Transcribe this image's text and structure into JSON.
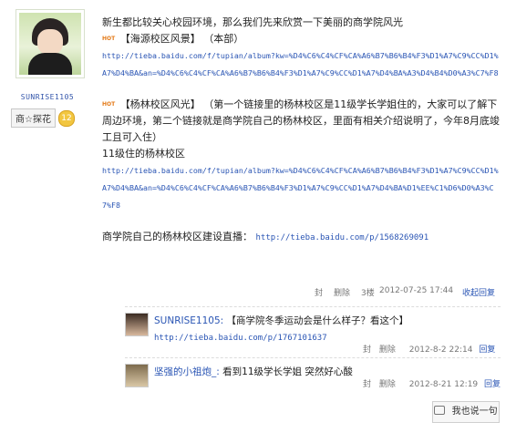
{
  "author": {
    "username": "SUNRISE1105",
    "badge_name": "商☆探花",
    "badge_level": "12"
  },
  "post": {
    "hot_tag": "HOT",
    "line1": "新生都比较关心校园环境，那么我们先来欣赏一下美丽的商学院风光",
    "section1_title": "【海源校区风景】",
    "section1_note": "（本部）",
    "link1": "http://tieba.baidu.com/f/tupian/album?kw=%D4%C6%C4%CF%CA%A6%B7%B6%B4%F3%D1%A7%C9%CC%D1%A7%D4%BA&an=%D4%C6%C4%CF%CA%A6%B7%B6%B4%F3%D1%A7%C9%CC%D1%A7%D4%BA%A3%D4%B4%D0%A3%C7%F8",
    "section2_title": "【杨林校区风光】",
    "section2_desc": "（第一个链接里的杨林校区是11级学长学姐住的，大家可以了解下周边环境，第二个链接就是商学院自己的杨林校区，里面有相关介绍说明了，今年8月底竣工且可入住）",
    "line_11": "11级住的杨林校区",
    "link2": "http://tieba.baidu.com/f/tupian/album?kw=%D4%C6%C4%CF%CA%A6%B7%B6%B4%F3%D1%A7%C9%CC%D1%A7%D4%BA&an=%D4%C6%C4%CF%CA%A6%B7%B6%B4%F3%D1%A7%C9%CC%D1%A7%D4%BA%D1%EE%C1%D6%D0%A3%C7%F8",
    "live_label": "商学院自己的杨林校区建设直播：",
    "live_link": "http://tieba.baidu.com/p/1568269091"
  },
  "post_meta": {
    "seal": "封",
    "delete": "删除",
    "floor": "3楼",
    "time": "2012-07-25 17:44",
    "collapse": "收起回复"
  },
  "replies": [
    {
      "user": "SUNRISE1105:",
      "text": "【商学院冬季运动会是什么样子？看这个】",
      "link": "http://tieba.baidu.com/p/1767101637",
      "seal": "封",
      "delete": "删除",
      "time": "2012-8-2 22:14",
      "reply": "回复"
    },
    {
      "user": "坚强的小祖炮_:",
      "text": "看到11级学长学姐 突然好心酸",
      "seal": "封",
      "delete": "删除",
      "time": "2012-8-21 12:19",
      "reply": "回复"
    }
  ],
  "say_button": "我也说一句"
}
